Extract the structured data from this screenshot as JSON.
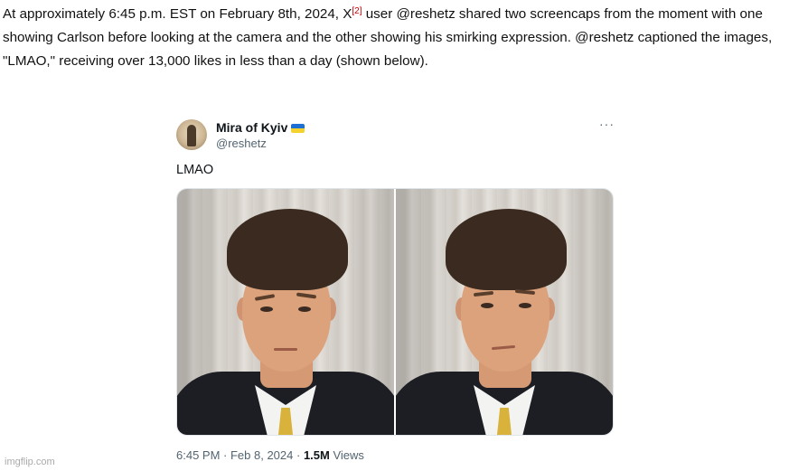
{
  "article": {
    "line1_before_ref": "At approximately 6:45 p.m. EST on February 8th, 2024, X",
    "ref": "[2]",
    "line1_after_ref": " user @reshetz shared two screencaps from the moment with one showing Carlson before looking at the camera and the other showing his smirking expression. @reshetz captioned the images, \"LMAO,\" receiving over 13,000 likes in less than a day (shown below)."
  },
  "tweet": {
    "display_name": "Mira of Kyiv",
    "handle": "@reshetz",
    "more_icon": "···",
    "text": "LMAO",
    "time": "6:45 PM",
    "sep1": " · ",
    "date": "Feb 8, 2024",
    "sep2": " · ",
    "views_count": "1.5M",
    "views_label": " Views",
    "flag_colors": [
      "#1d6fd1",
      "#f4d12d"
    ]
  },
  "watermark": "imgflip.com"
}
